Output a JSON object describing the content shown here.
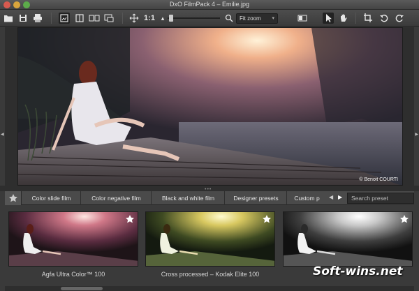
{
  "window": {
    "title": "DxO FilmPack 4 – Emilie.jpg"
  },
  "toolbar": {
    "icons": [
      "folder-icon",
      "save-icon",
      "print-icon",
      "single-view-icon",
      "before-after-icon",
      "side-by-side-icon",
      "compare-icon",
      "move-icon",
      "hand-icon",
      "crop-icon",
      "rotate-left-icon",
      "rotate-right-icon"
    ],
    "zoom_one_to_one": "1:1",
    "zoom_select_value": "Fit zoom"
  },
  "photo": {
    "credit": "© Benoit COURTI"
  },
  "tabs": {
    "items": [
      {
        "label": "Color slide film"
      },
      {
        "label": "Color negative film"
      },
      {
        "label": "Black and white film"
      },
      {
        "label": "Designer presets"
      },
      {
        "label": "Custom p"
      }
    ],
    "search_placeholder": "Search preset"
  },
  "presets": {
    "items": [
      {
        "label": "Agfa Ultra Color™ 100"
      },
      {
        "label": "Cross processed – Kodak Elite 100"
      },
      {
        "label": ""
      }
    ]
  },
  "watermark": "Soft-wins.net",
  "colors": {
    "accent": "#ffffff",
    "panel": "#3a3a3a"
  }
}
